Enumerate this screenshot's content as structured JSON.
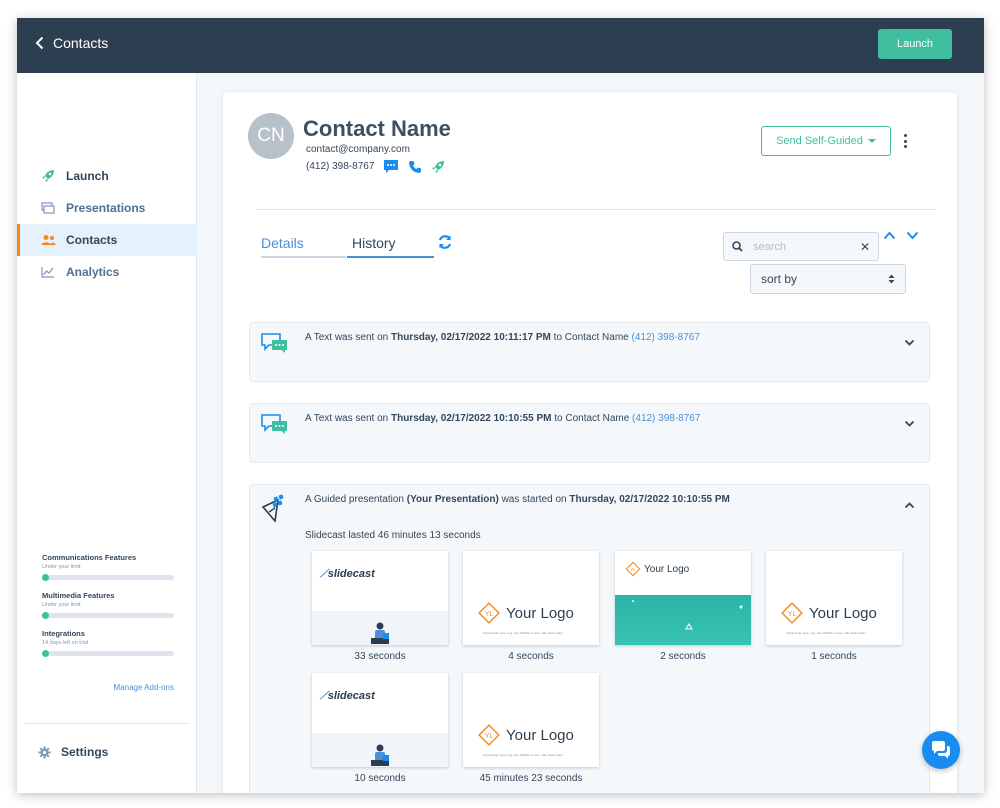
{
  "header": {
    "back_label": "Contacts",
    "launch_label": "Launch"
  },
  "sidebar": {
    "items": [
      {
        "label": "Launch",
        "icon": "rocket-icon"
      },
      {
        "label": "Presentations",
        "icon": "presentations-icon"
      },
      {
        "label": "Contacts",
        "icon": "contacts-icon",
        "active": true
      },
      {
        "label": "Analytics",
        "icon": "analytics-icon"
      }
    ],
    "features": [
      {
        "title": "Communications Features",
        "subtitle": "Under your limit",
        "progress": 0.05
      },
      {
        "title": "Multimedia Features",
        "subtitle": "Under your limit",
        "progress": 0.05
      },
      {
        "title": "Integrations",
        "subtitle": "14 days left on trial",
        "progress": 0.05
      }
    ],
    "manage_addons": "Manage Add-ons",
    "settings_label": "Settings"
  },
  "contact": {
    "initials": "CN",
    "name": "Contact Name",
    "email": "contact@company.com",
    "phone": "(412) 398-8767",
    "send_button": "Send Self-Guided"
  },
  "tabs": {
    "details": "Details",
    "history": "History",
    "active": "History"
  },
  "search": {
    "placeholder": "search",
    "sort_placeholder": "sort by"
  },
  "history": [
    {
      "prefix": "A Text was sent on ",
      "datetime": "Thursday, 02/17/2022 10:11:17 PM",
      "middle": " to Contact Name ",
      "link": "(412) 398-8767",
      "expanded": false
    },
    {
      "prefix": "A Text was sent on ",
      "datetime": "Thursday, 02/17/2022 10:10:55 PM",
      "middle": " to Contact Name ",
      "link": "(412) 398-8767",
      "expanded": false
    },
    {
      "prefix": "A Guided presentation ",
      "presentation": "(Your Presentation)",
      "middle": " was started on ",
      "datetime": "Thursday, 02/17/2022 10:10:55 PM",
      "duration_text": "Slidecast lasted 46 minutes 13 seconds",
      "expanded": true,
      "slides": [
        {
          "type": "slidecast",
          "logo": "slidecast",
          "caption": "33 seconds"
        },
        {
          "type": "yourlogo",
          "logo": "Your Logo",
          "subtext": "(Optimal file type: png, size 9000kb or less, 300 pixels wide)",
          "caption": "4 seconds"
        },
        {
          "type": "yourlogo-teal",
          "logo": "Your Logo",
          "caption": "2 seconds"
        },
        {
          "type": "yourlogo",
          "logo": "Your Logo",
          "subtext": "(Optimal file type: png, size 9000kb or less, 300 pixels wide)",
          "caption": "1 seconds"
        },
        {
          "type": "slidecast",
          "logo": "slidecast",
          "caption": "10 seconds"
        },
        {
          "type": "yourlogo",
          "logo": "Your Logo",
          "subtext": "(Optimal file type: png, size 9000kb or less, 300 pixels wide)",
          "caption": "45 minutes 23 seconds"
        }
      ]
    }
  ],
  "colors": {
    "topbar": "#2d3e50",
    "accent_teal": "#3fbfa0",
    "link_blue": "#4a90d9",
    "active_marker": "#f5871f",
    "chat_fab": "#1a8cf0"
  }
}
